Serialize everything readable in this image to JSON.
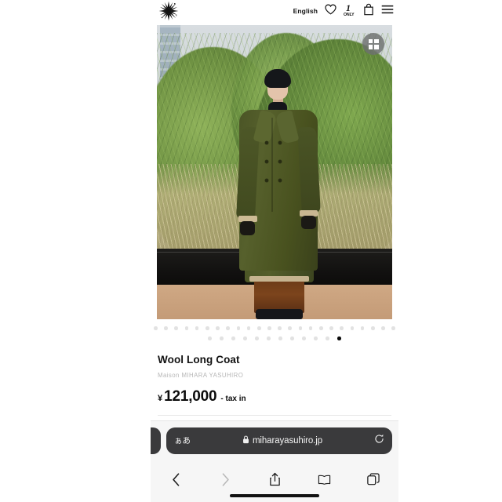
{
  "site": {
    "logo_name": "starburst-logo",
    "header": {
      "language_label": "English",
      "wishlist_icon": "heart-icon",
      "only_badge": {
        "number": "1",
        "word": "ONLY"
      },
      "cart_icon": "shopping-bag-icon",
      "menu_icon": "hamburger-menu-icon"
    }
  },
  "gallery": {
    "grid_toggle_icon": "grid-view-icon",
    "alt": "Model wearing olive green wool long coat outdoors with green foliage background",
    "dots_row1_count": 24,
    "dots_row2_count": 12,
    "active_dot_index": 11,
    "active_dot_row": 2
  },
  "product": {
    "title": "Wool Long Coat",
    "brand": "Maison MIHARA YASUHIRO",
    "price": {
      "currency_symbol": "¥",
      "amount": "121,000",
      "tax_note": "- tax in"
    }
  },
  "browser": {
    "text_size_button": "ぁあ",
    "lock_icon": "lock-icon",
    "url": "miharayasuhiro.jp",
    "reload_icon": "reload-icon",
    "toolbar": {
      "back_icon": "chevron-left-icon",
      "forward_icon": "chevron-right-icon",
      "share_icon": "share-icon",
      "bookmarks_icon": "book-icon",
      "tabs_icon": "tabs-icon"
    },
    "colors": {
      "addressbar_bg": "#3a3a3c",
      "chrome_bg": "#f6f6f6",
      "accent_text": "#f4f4f4"
    }
  }
}
